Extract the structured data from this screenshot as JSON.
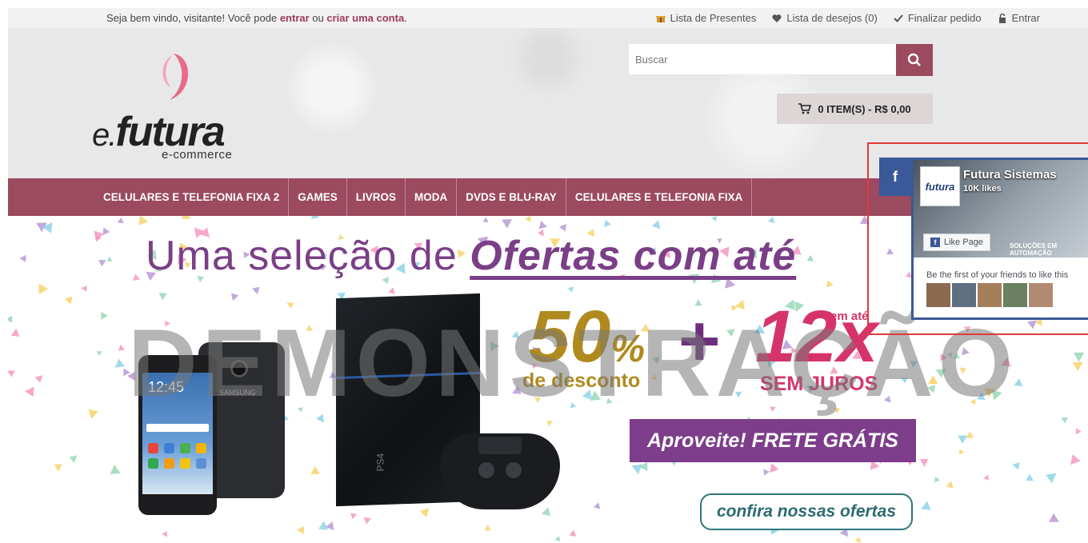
{
  "topbar": {
    "welcome_prefix": "Seja bem vindo, visitante! Você pode ",
    "login_link": "entrar",
    "or": " ou ",
    "signup_link": "criar uma conta",
    "suffix": ".",
    "links": [
      {
        "icon": "gift-icon",
        "label": "Lista de Presentes"
      },
      {
        "icon": "heart-icon",
        "label": "Lista de desejos (0)"
      },
      {
        "icon": "check-icon",
        "label": "Finalizar pedido"
      },
      {
        "icon": "lock-icon",
        "label": "Entrar"
      }
    ]
  },
  "header": {
    "logo_text": "futura",
    "logo_prefix": "e.",
    "logo_sub": "e-commerce",
    "search_placeholder": "Buscar",
    "cart_label": "0 ITEM(S) - R$ 0,00"
  },
  "nav": {
    "items": [
      "CELULARES E TELEFONIA FIXA 2",
      "GAMES",
      "LIVROS",
      "MODA",
      "DVDS E BLU-RAY",
      "CELULARES E TELEFONIA FIXA"
    ]
  },
  "banner": {
    "headline_plain": "Uma seleção de ",
    "headline_em": "Ofertas com até",
    "watermark": "DEMONSTRAÇÃO",
    "percent": "50",
    "percent_sign": "%",
    "discount_label": "de desconto",
    "plus": "+",
    "installments": "12x",
    "em_ate": "em até",
    "sem_juros": "SEM JUROS",
    "frete": "Aproveite! FRETE GRÁTIS",
    "cta": "confira nossas ofertas",
    "phone_brand": "SAMSUNG",
    "phone_time": "12:45",
    "console_label": "PS4"
  },
  "facebook": {
    "tab_label": "f",
    "page_name": "Futura Sistemas",
    "likes": "10K likes",
    "like_button": "Like Page",
    "logo_text": "futura",
    "solucoes": "SOLUÇÕES EM AUTOMAÇÃO",
    "friends_text": "Be the first of your friends to like this"
  },
  "colors": {
    "brand": "#9b4a60",
    "accent_purple": "#7d3d8b",
    "gold": "#b08a1f",
    "pink": "#d6336c",
    "fb_blue": "#3b5998"
  }
}
